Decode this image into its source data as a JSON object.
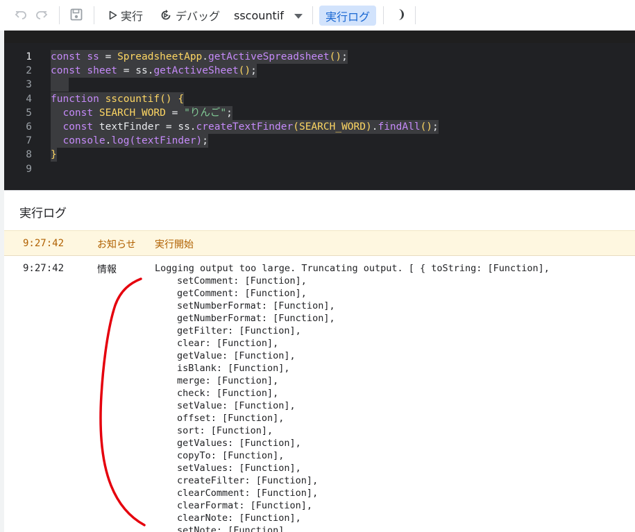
{
  "toolbar": {
    "run_label": "実行",
    "debug_label": "デバッグ",
    "function_selected": "sscountif",
    "execution_log_label": "実行ログ"
  },
  "editor": {
    "lines": [
      {
        "num": "1",
        "segments": [
          [
            "kw",
            "const "
          ],
          [
            "var",
            "ss"
          ],
          [
            "plain",
            " = "
          ],
          [
            "fn",
            "SpreadsheetApp"
          ],
          [
            "plain",
            "."
          ],
          [
            "prop",
            "getActiveSpreadsheet"
          ],
          [
            "brk",
            "()"
          ],
          [
            "plain",
            ";"
          ]
        ]
      },
      {
        "num": "2",
        "segments": [
          [
            "kw",
            "const "
          ],
          [
            "var",
            "sheet"
          ],
          [
            "plain",
            " = "
          ],
          [
            "plain",
            "ss."
          ],
          [
            "prop",
            "getActiveSheet"
          ],
          [
            "brk",
            "()"
          ],
          [
            "plain",
            ";"
          ]
        ]
      },
      {
        "num": "3",
        "segments": []
      },
      {
        "num": "4",
        "segments": [
          [
            "kw",
            "function "
          ],
          [
            "fn",
            "sscountif"
          ],
          [
            "brk",
            "() {"
          ]
        ]
      },
      {
        "num": "5",
        "segments": [
          [
            "plain",
            "  "
          ],
          [
            "kw",
            "const "
          ],
          [
            "fn",
            "SEARCH_WORD"
          ],
          [
            "plain",
            " = "
          ],
          [
            "str",
            "\"りんご\""
          ],
          [
            "plain",
            ";"
          ]
        ]
      },
      {
        "num": "6",
        "segments": [
          [
            "plain",
            "  "
          ],
          [
            "kw",
            "const "
          ],
          [
            "plain",
            "textFinder = ss."
          ],
          [
            "prop",
            "createTextFinder"
          ],
          [
            "brk",
            "("
          ],
          [
            "fn",
            "SEARCH_WORD"
          ],
          [
            "brk",
            ")"
          ],
          [
            "plain",
            "."
          ],
          [
            "prop",
            "findAll"
          ],
          [
            "brk",
            "()"
          ],
          [
            "plain",
            ";"
          ]
        ]
      },
      {
        "num": "7",
        "segments": [
          [
            "plain",
            "  "
          ],
          [
            "prop",
            "console"
          ],
          [
            "plain",
            "."
          ],
          [
            "prop",
            "log"
          ],
          [
            "kw",
            "(textFinder)"
          ],
          [
            "plain",
            ";"
          ]
        ]
      },
      {
        "num": "8",
        "segments": [
          [
            "brk",
            "}"
          ]
        ]
      },
      {
        "num": "9",
        "segments": []
      }
    ]
  },
  "log": {
    "title": "実行ログ",
    "notice": {
      "time": "9:27:42",
      "level": "お知らせ",
      "message": "実行開始"
    },
    "info": {
      "time": "9:27:42",
      "level": "情報",
      "first_line": "Logging output too large. Truncating output. [ { toString: [Function],",
      "lines": [
        "setComment: [Function],",
        "getComment: [Function],",
        "setNumberFormat: [Function],",
        "getNumberFormat: [Function],",
        "getFilter: [Function],",
        "clear: [Function],",
        "getValue: [Function],",
        "isBlank: [Function],",
        "merge: [Function],",
        "check: [Function],",
        "setValue: [Function],",
        "offset: [Function],",
        "sort: [Function],",
        "getValues: [Function],",
        "copyTo: [Function],",
        "setValues: [Function],",
        "createFilter: [Function],",
        "clearComment: [Function],",
        "clearFormat: [Function],",
        "clearNote: [Function],",
        "setNote: [Function],"
      ]
    }
  },
  "colors": {
    "accent": "#1967d2",
    "accent_bg": "#d2e3fc",
    "notice_bg": "#fef7e0",
    "notice_text": "#b06000",
    "editor_bg": "#202124",
    "annotation": "#e5000d"
  },
  "icons": [
    "undo-icon",
    "redo-icon",
    "save-icon",
    "play-icon",
    "debug-icon",
    "dropdown-caret-icon",
    "theme-moon-icon"
  ]
}
